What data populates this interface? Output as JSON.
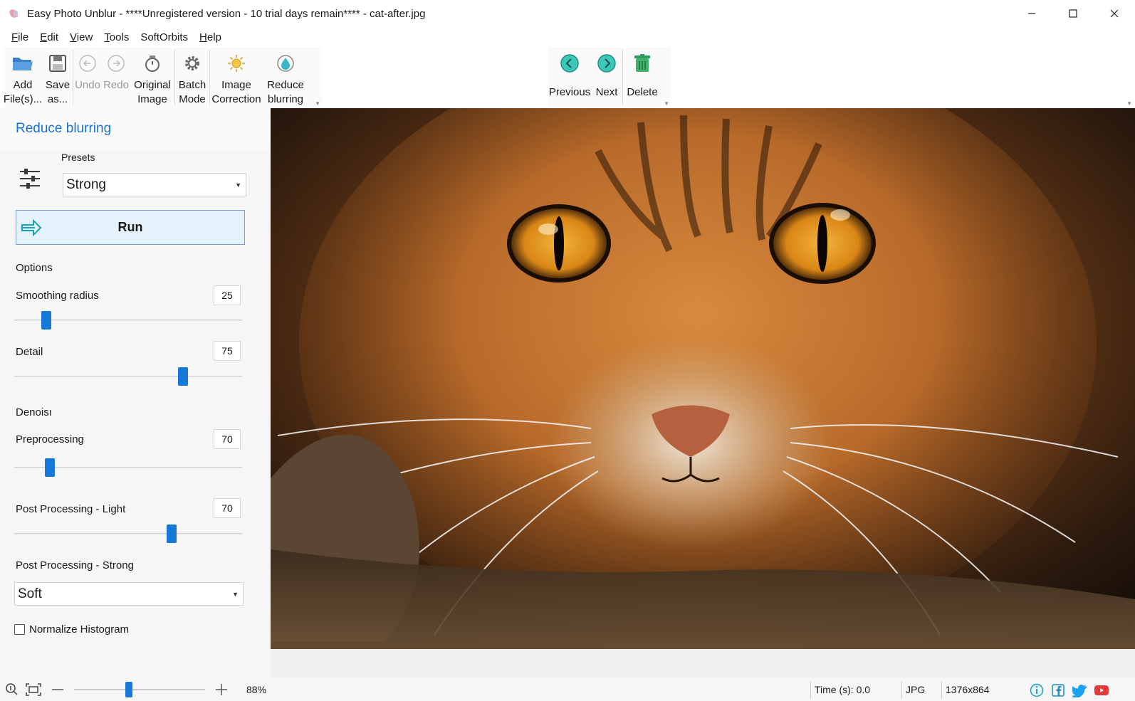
{
  "window": {
    "title": "Easy Photo Unblur - ****Unregistered version - 10 trial days remain**** - cat-after.jpg",
    "minimize": "—",
    "maximize": "☐",
    "close": "✕"
  },
  "menu": {
    "items": [
      {
        "pre": "",
        "u": "F",
        "post": "ile"
      },
      {
        "pre": "",
        "u": "E",
        "post": "dit"
      },
      {
        "pre": "",
        "u": "V",
        "post": "iew"
      },
      {
        "pre": "",
        "u": "T",
        "post": "ools"
      },
      {
        "pre": "SoftOrbits",
        "u": "",
        "post": ""
      },
      {
        "pre": "",
        "u": "H",
        "post": "elp"
      }
    ]
  },
  "toolbar": {
    "add_files": {
      "line1": "Add",
      "line2": "File(s)..."
    },
    "save_as": {
      "line1": "Save",
      "line2": "as..."
    },
    "undo": "Undo",
    "redo": "Redo",
    "original_image": {
      "line1": "Original",
      "line2": "Image"
    },
    "batch_mode": {
      "line1": "Batch",
      "line2": "Mode"
    },
    "image_correction": {
      "line1": "Image",
      "line2": "Correction"
    },
    "reduce_blurring": {
      "line1": "Reduce",
      "line2": "blurring"
    },
    "previous": "Previous",
    "next": "Next",
    "delete": "Delete"
  },
  "panel": {
    "title": "Reduce blurring",
    "presets_label": "Presets",
    "preset_value": "Strong",
    "run_label": "Run",
    "options_label": "Options",
    "smoothing_radius": {
      "label": "Smoothing radius",
      "value": "25",
      "position": 0.14
    },
    "detail": {
      "label": "Detail",
      "value": "75",
      "position": 0.74
    },
    "denoise_label": "Denoisı",
    "preprocessing": {
      "label": "Preprocessing",
      "value": "70",
      "position": 0.155
    },
    "post_light": {
      "label": "Post Processing - Light",
      "value": "70",
      "position": 0.69
    },
    "post_strong": {
      "label": "Post Processing - Strong",
      "value": "Soft"
    },
    "normalize_label": "Normalize Histogram",
    "normalize_checked": false
  },
  "status": {
    "zoom_percent": "88%",
    "zoom_position": 0.42,
    "time": "Time (s): 0.0",
    "format": "JPG",
    "dimensions": "1376x864"
  },
  "colors": {
    "accent": "#1577d8",
    "panel_title": "#1873cc",
    "nav_circle": "#3cc7b8",
    "delete_green": "#3fb26b"
  }
}
